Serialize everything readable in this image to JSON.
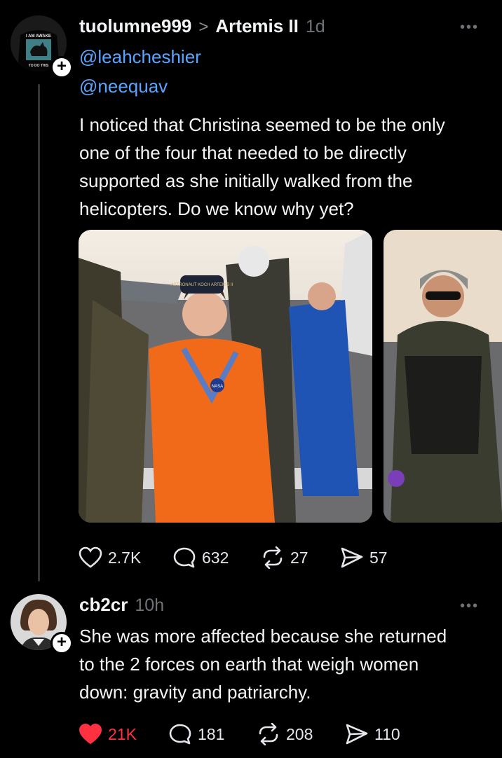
{
  "post": {
    "username": "tuolumne999",
    "separator": ">",
    "topic": "Artemis II",
    "time": "1d",
    "mentions": [
      "@leahcheshier",
      "@neequav"
    ],
    "text_lines": [
      "I noticed that Christina seemed to be the only",
      "one of the four that needed to be directly",
      "supported as she initially walked from the",
      "helicopters.  Do we know why yet?"
    ],
    "avatar_text": {
      "line1": "I AM AWAKE",
      "line2": "TO DO THIS"
    },
    "photo1_text": {
      "cap": "ASTRONAUT KOCH ARTEMIS II",
      "patch": "NASA"
    },
    "actions": {
      "likes": "2.7K",
      "replies": "632",
      "reposts": "27",
      "shares": "57"
    }
  },
  "reply": {
    "username": "cb2cr",
    "time": "10h",
    "text_lines": [
      "She was more affected because she returned",
      "to the 2 forces on earth that weigh women",
      "down: gravity and patriarchy."
    ],
    "actions": {
      "likes": "21K",
      "replies": "181",
      "reposts": "208",
      "shares": "110"
    }
  },
  "colors": {
    "background": "#000000",
    "mention": "#5aa5ff",
    "liked_heart": "#ff3040",
    "muted": "#6f7378"
  }
}
